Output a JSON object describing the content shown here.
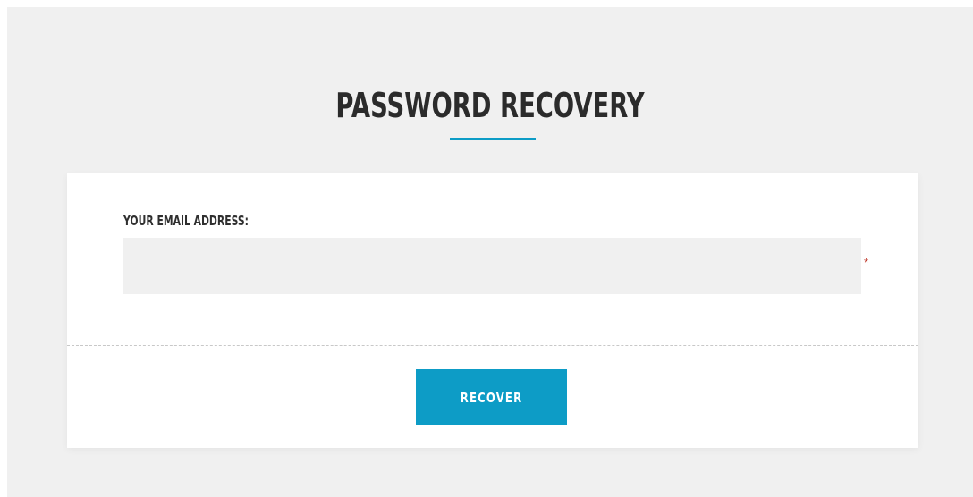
{
  "page": {
    "title": "PASSWORD RECOVERY"
  },
  "form": {
    "email_label": "YOUR EMAIL ADDRESS:",
    "email_value": "",
    "email_placeholder": "",
    "required_marker": "*",
    "submit_label": "RECOVER"
  },
  "colors": {
    "accent": "#0d9cc6",
    "background": "#f0f0f0",
    "card": "#ffffff",
    "required": "#c0392b"
  }
}
